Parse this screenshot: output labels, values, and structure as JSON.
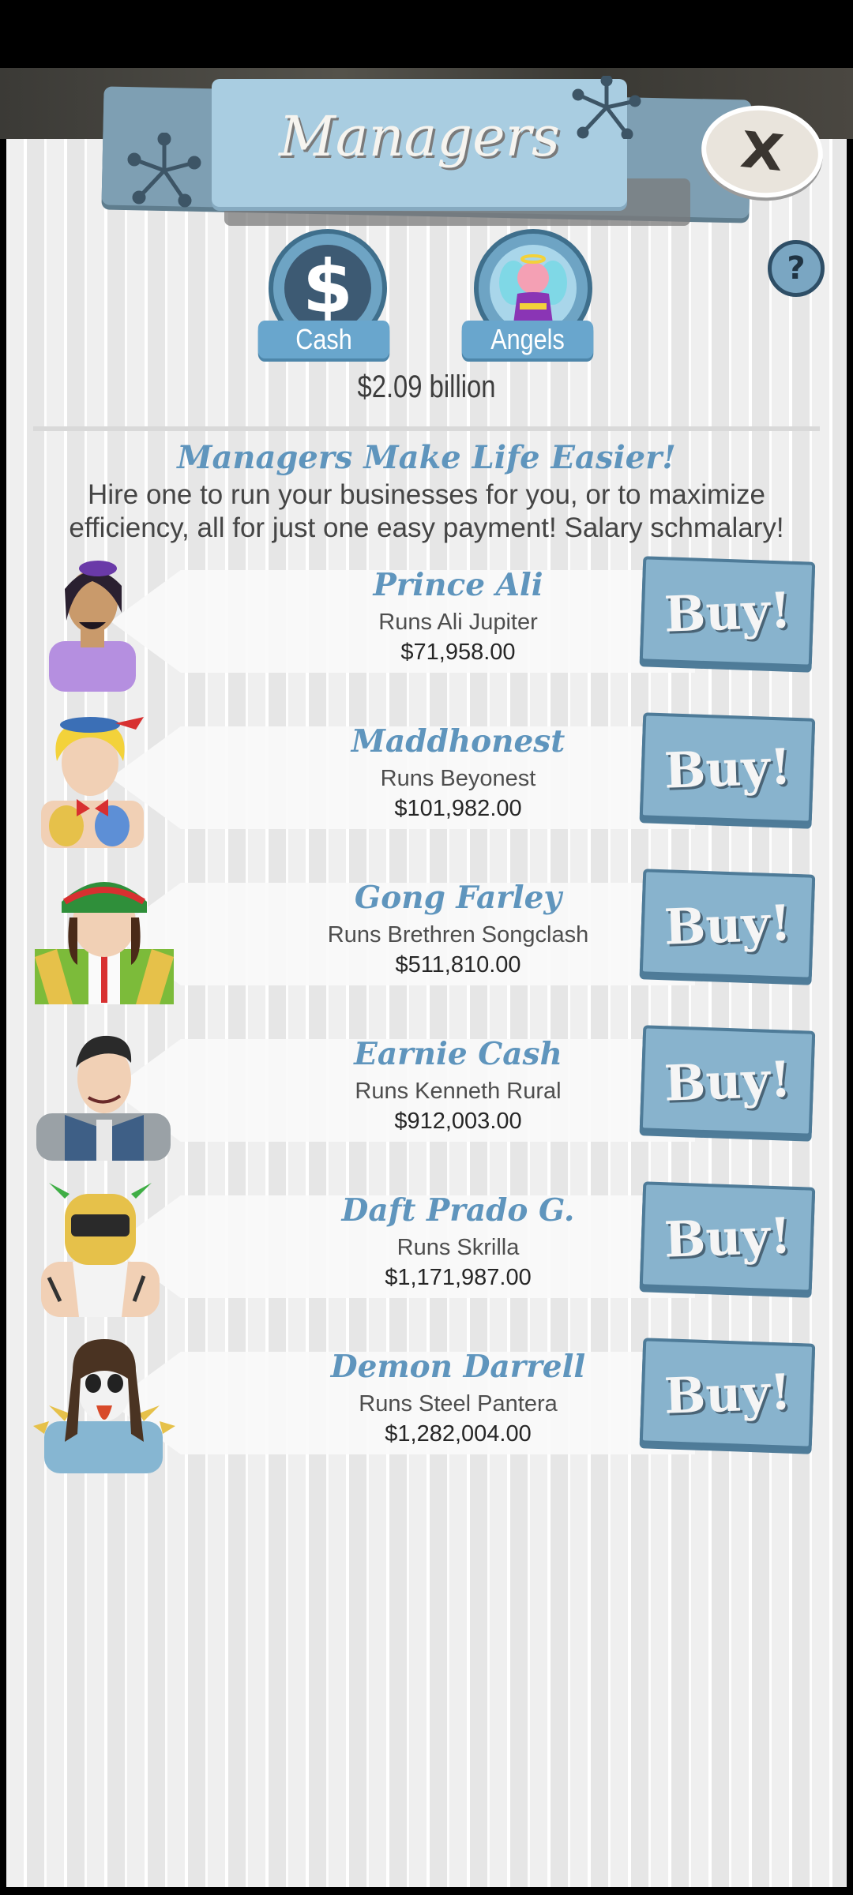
{
  "header": {
    "title": "Managers"
  },
  "currency": {
    "cash_label": "Cash",
    "angels_label": "Angels",
    "balance": "$2.09 billion"
  },
  "intro": {
    "tagline": "Managers Make Life Easier!",
    "description": "Hire one to run your businesses for you, or to maximize efficiency, all for just one easy payment! Salary schmalary!"
  },
  "buy_label": "Buy!",
  "managers": [
    {
      "name": "Prince Ali",
      "runs": "Runs Ali Jupiter",
      "cost": "$71,958.00"
    },
    {
      "name": "Maddhonest",
      "runs": "Runs Beyonest",
      "cost": "$101,982.00"
    },
    {
      "name": "Gong Farley",
      "runs": "Runs Brethren Songclash",
      "cost": "$511,810.00"
    },
    {
      "name": "Earnie Cash",
      "runs": "Runs Kenneth Rural",
      "cost": "$912,003.00"
    },
    {
      "name": "Daft Prado G.",
      "runs": "Runs Skrilla",
      "cost": "$1,171,987.00"
    },
    {
      "name": "Demon Darrell",
      "runs": "Runs Steel Pantera",
      "cost": "$1,282,004.00"
    }
  ],
  "colors": {
    "accent": "#5f95bd",
    "button": "#88b3cd",
    "panel": "#efefef"
  }
}
